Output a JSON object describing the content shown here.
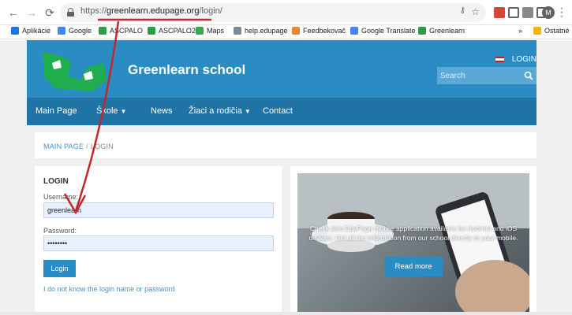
{
  "browser": {
    "url_protocol": "https://",
    "url_host": "greenlearn.edupage.org",
    "url_path": "/login/",
    "profile_initial": "M"
  },
  "bookmarks": [
    {
      "label": "Aplikácie",
      "icon": "apps-grid-icon",
      "color": "#1a73e8"
    },
    {
      "label": "Google",
      "icon": "google-icon",
      "color": "#4285f4"
    },
    {
      "label": "ASCPALO",
      "icon": "ascpalo-icon",
      "color": "#2e9b47"
    },
    {
      "label": "ASCPALO2",
      "icon": "ascpalo-icon",
      "color": "#2e9b47"
    },
    {
      "label": "Maps",
      "icon": "maps-icon",
      "color": "#34a853"
    },
    {
      "label": "help.edupage",
      "icon": "doc-icon",
      "color": "#7a8a99"
    },
    {
      "label": "Feedbekovač",
      "icon": "feedback-icon",
      "color": "#e38b2b"
    },
    {
      "label": "Google Translate",
      "icon": "translate-icon",
      "color": "#4285f4"
    },
    {
      "label": "Greenlearn",
      "icon": "greenlearn-icon",
      "color": "#2e9b47"
    }
  ],
  "bookmarks_overflow": "»",
  "bookmarks_other": "Ostatné",
  "header": {
    "site_title": "Greenlearn school",
    "login_link": "LOGIN",
    "search_placeholder": "Search"
  },
  "nav": [
    {
      "label": "Main Page",
      "dropdown": false
    },
    {
      "label": "Škole",
      "dropdown": true
    },
    {
      "label": "News",
      "dropdown": false
    },
    {
      "label": "Žiaci a rodičia",
      "dropdown": true
    },
    {
      "label": "Contact",
      "dropdown": false
    }
  ],
  "breadcrumb": {
    "home": "MAIN PAGE",
    "separator": "/",
    "current": "LOGIN"
  },
  "login": {
    "title": "LOGIN",
    "username_label": "Username:",
    "username_value": "greenlearn",
    "password_label": "Password:",
    "password_value": "••••••••",
    "submit_label": "Login",
    "forgot_link": "I do not know the login name or password"
  },
  "promo": {
    "text": "Check also EduPage mobile application available for Android and iOS devices. Get all the information from our school directly to your mobile.",
    "button_label": "Read more"
  },
  "colors": {
    "brand_blue": "#2b8cc4",
    "nav_blue": "#1f74a5",
    "annotation_red": "#c0282d",
    "logo_green": "#1eae4d"
  }
}
